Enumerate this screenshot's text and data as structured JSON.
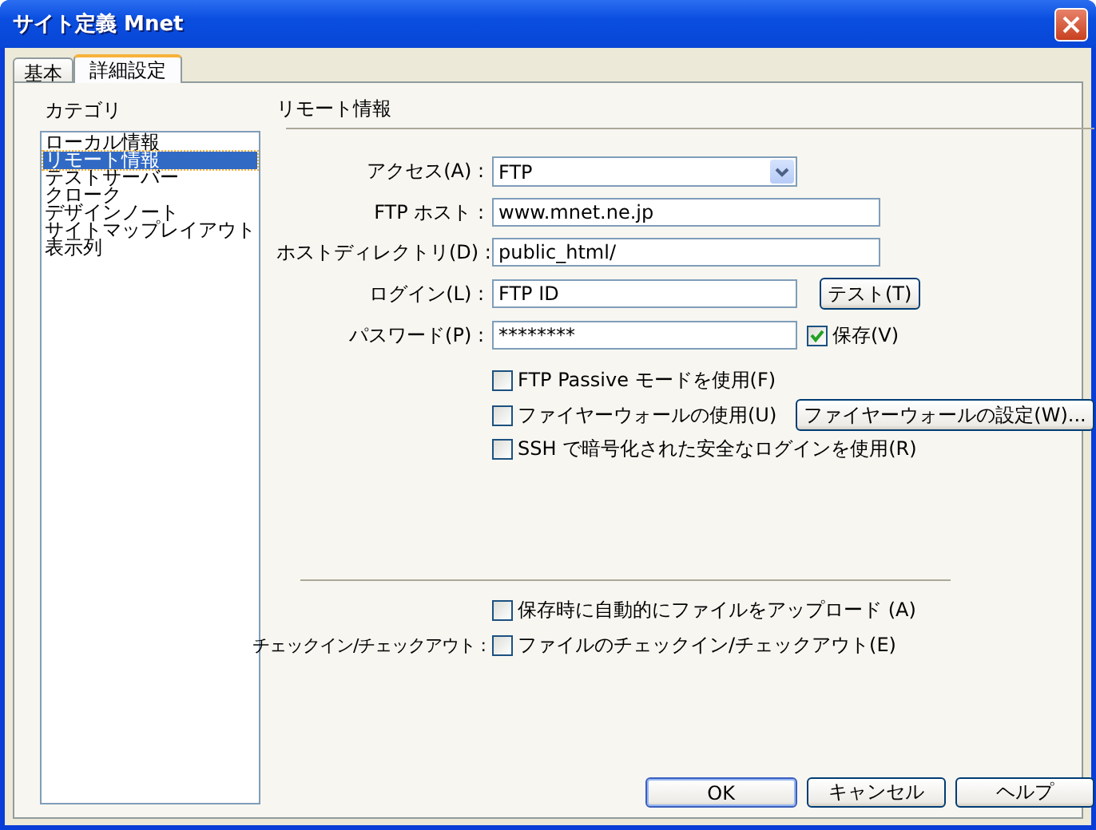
{
  "window": {
    "title": "サイト定義 Mnet"
  },
  "tabs": [
    {
      "label": "基本",
      "selected": false
    },
    {
      "label": "詳細設定",
      "selected": true
    }
  ],
  "category": {
    "label": "カテゴリ",
    "items": [
      {
        "label": "ローカル情報",
        "selected": false
      },
      {
        "label": "リモート情報",
        "selected": true
      },
      {
        "label": "テストサーバー",
        "selected": false
      },
      {
        "label": "クローク",
        "selected": false
      },
      {
        "label": "デザインノート",
        "selected": false
      },
      {
        "label": "サイトマップレイアウト",
        "selected": false
      },
      {
        "label": "表示列",
        "selected": false
      }
    ]
  },
  "section": {
    "title": "リモート情報"
  },
  "fields": [
    {
      "kind": "select",
      "label": "アクセス(A) :",
      "value": "FTP"
    },
    {
      "kind": "text",
      "label": "FTP ホスト :",
      "value": "www.mnet.ne.jp"
    },
    {
      "kind": "text",
      "label": "ホストディレクトリ(D) :",
      "value": "public_html/"
    },
    {
      "kind": "short",
      "label": "ログイン(L) :",
      "value": "FTP ID",
      "button": "テスト(T)"
    },
    {
      "kind": "short",
      "label": "パスワード(P) :",
      "value": "********",
      "checkbox": {
        "label": "保存(V)",
        "checked": true
      }
    }
  ],
  "options": [
    {
      "label": "FTP Passive モードを使用(F)",
      "checked": false
    },
    {
      "label": "ファイヤーウォールの使用(U)",
      "checked": false,
      "button": "ファイヤーウォールの設定(W)..."
    },
    {
      "label": "SSH で暗号化された安全なログインを使用(R)",
      "checked": false
    }
  ],
  "checkin": [
    {
      "label": "保存時に自動的にファイルをアップロード (A)",
      "checked": false
    },
    {
      "caption": "チェックイン/チェックアウト :",
      "label": "ファイルのチェックイン/チェックアウト(E)",
      "checked": false
    }
  ],
  "buttons": [
    "OK",
    "キャンセル",
    "ヘルプ"
  ]
}
